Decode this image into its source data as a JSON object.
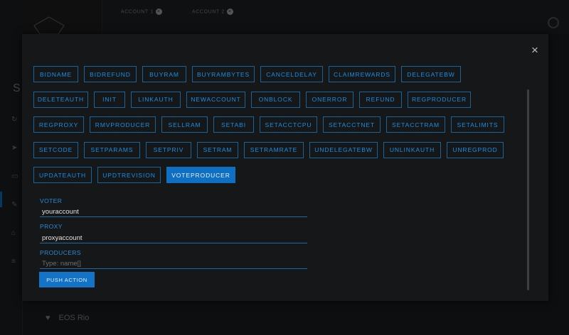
{
  "background": {
    "tabs": [
      {
        "label": "ACCOUNT 1",
        "close_glyph": "×"
      },
      {
        "label": "ACCOUNT 2",
        "close_glyph": "×"
      }
    ],
    "sidebar_letter": "S",
    "sidebar_icons": [
      "refresh-icon",
      "send-icon",
      "wallet-icon",
      "edit-icon",
      "bank-icon",
      "database-icon"
    ],
    "footer_label": "EOS Rio",
    "footer_icon": "heart-icon"
  },
  "modal": {
    "close_glyph": "×",
    "actions": [
      [
        "BIDNAME",
        "BIDREFUND",
        "BUYRAM",
        "BUYRAMBYTES",
        "CANCELDELAY",
        "CLAIMREWARDS",
        "DELEGATEBW"
      ],
      [
        "DELETEAUTH",
        "INIT",
        "LINKAUTH",
        "NEWACCOUNT",
        "ONBLOCK",
        "ONERROR",
        "REFUND",
        "REGPRODUCER"
      ],
      [
        "REGPROXY",
        "RMVPRODUCER",
        "SELLRAM",
        "SETABI",
        "SETACCTCPU",
        "SETACCTNET",
        "SETACCTRAM",
        "SETALIMITS"
      ],
      [
        "SETCODE",
        "SETPARAMS",
        "SETPRIV",
        "SETRAM",
        "SETRAMRATE",
        "UNDELEGATEBW",
        "UNLINKAUTH",
        "UNREGPROD"
      ],
      [
        "UPDATEAUTH",
        "UPDTREVISION",
        "VOTEPRODUCER"
      ]
    ],
    "selected_action": "VOTEPRODUCER",
    "fields": {
      "voter": {
        "label": "VOTER",
        "value": "youraccount",
        "placeholder": ""
      },
      "proxy": {
        "label": "PROXY",
        "value": "proxyaccount",
        "placeholder": ""
      },
      "producers": {
        "label": "PRODUCERS",
        "value": "",
        "placeholder": "Type: name[]"
      }
    },
    "push_label": "PUSH ACTION"
  },
  "colors": {
    "accent": "#1273c7",
    "button_text": "#1590e8",
    "button_border": "#14649e",
    "modal_bg": "#161718"
  }
}
